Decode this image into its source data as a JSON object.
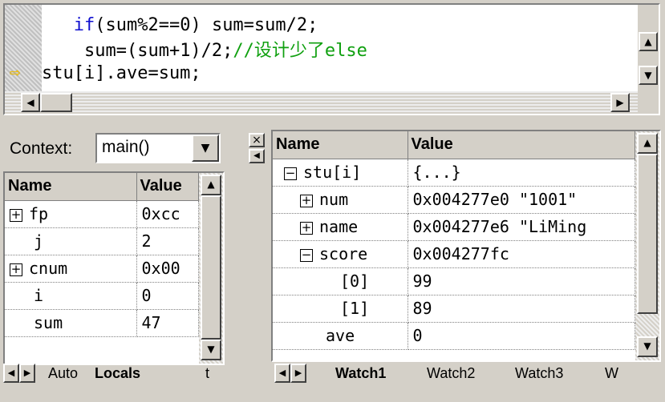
{
  "editor": {
    "lines": [
      {
        "indent": "   ",
        "keyword": "if",
        "rest": "(sum%2==0) sum=sum/2;"
      },
      {
        "indent": "    ",
        "code": "sum=(sum+1)/2;",
        "comment": "//设计少了else"
      },
      {
        "code": "stu[i].ave=sum;"
      }
    ],
    "current_line_marker": "⇨"
  },
  "locals": {
    "context_label": "Context:",
    "context_value": "main()",
    "columns": [
      "Name",
      "Value"
    ],
    "rows": [
      {
        "name": "fp",
        "value": "0xcc",
        "expand": "+"
      },
      {
        "name": "j",
        "value": "2"
      },
      {
        "name": "cnum",
        "value": "0x00",
        "expand": "+"
      },
      {
        "name": "i",
        "value": "0"
      },
      {
        "name": "sum",
        "value": "47"
      }
    ],
    "tabs": [
      "Auto",
      "Locals",
      "t"
    ]
  },
  "watch": {
    "columns": [
      "Name",
      "Value"
    ],
    "rows": [
      {
        "name": "stu[i]",
        "value": "{...}",
        "expand": "−"
      },
      {
        "name": "num",
        "value": "0x004277e0 \"1001\"",
        "expand": "+"
      },
      {
        "name": "name",
        "value": "0x004277e6 \"LiMing",
        "expand": "+"
      },
      {
        "name": "score",
        "value": "0x004277fc",
        "expand": "−"
      },
      {
        "name": "[0]",
        "value": "99"
      },
      {
        "name": "[1]",
        "value": "89"
      },
      {
        "name": "ave",
        "value": "0"
      }
    ],
    "tabs": [
      "Watch1",
      "Watch2",
      "Watch3",
      "W"
    ]
  },
  "icons": {
    "up": "▲",
    "down": "▼",
    "left": "◀",
    "right": "▶",
    "close": "×"
  }
}
